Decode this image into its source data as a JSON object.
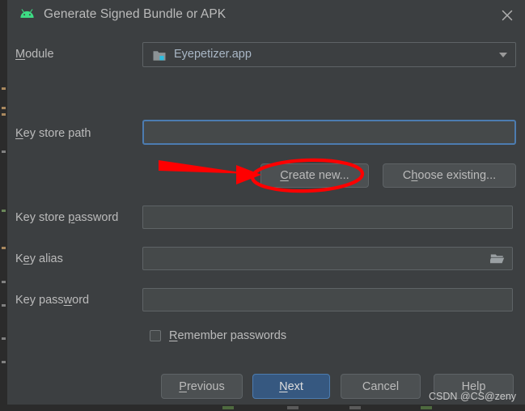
{
  "window": {
    "title": "Generate Signed Bundle or APK",
    "app_icon": "android-robot-icon",
    "close_icon": "close-icon",
    "background_color": "#3C3F41",
    "accent_color": "#4C7CB0",
    "annotation_color": "#FF0000"
  },
  "form": {
    "module": {
      "label_prefix": "",
      "label_mnemonic": "M",
      "label_suffix": "odule",
      "value": "Eyepetizer.app",
      "icon": "folder-module-icon",
      "dropdown_icon": "chevron-down-icon"
    },
    "key_store_path": {
      "label_prefix": "",
      "label_mnemonic": "K",
      "label_suffix": "ey store path",
      "value": "",
      "placeholder": "",
      "focused": true
    },
    "key_store_password": {
      "label_prefix": "Key store ",
      "label_mnemonic": "p",
      "label_suffix": "assword",
      "value": "",
      "placeholder": ""
    },
    "key_alias": {
      "label_prefix": "K",
      "label_mnemonic": "e",
      "label_suffix": "y alias",
      "value": "",
      "placeholder": "",
      "icon": "folder-open-icon"
    },
    "key_password": {
      "label_prefix": "Key pass",
      "label_mnemonic": "w",
      "label_suffix": "ord",
      "value": "",
      "placeholder": ""
    },
    "remember_passwords": {
      "label_prefix": "",
      "label_mnemonic": "R",
      "label_suffix": "emember passwords",
      "checked": false
    }
  },
  "keystore_buttons": {
    "create_new": {
      "prefix": "",
      "mnemonic": "C",
      "suffix": "reate new..."
    },
    "choose_existing": {
      "prefix": "C",
      "mnemonic": "h",
      "suffix": "oose existing..."
    }
  },
  "footer_buttons": {
    "previous": {
      "prefix": "",
      "mnemonic": "P",
      "suffix": "revious"
    },
    "next": {
      "prefix": "",
      "mnemonic": "N",
      "suffix": "ext"
    },
    "cancel": {
      "prefix": "Cancel",
      "mnemonic": "",
      "suffix": ""
    },
    "help": {
      "prefix": "Help",
      "mnemonic": "",
      "suffix": ""
    }
  },
  "watermark": {
    "text": "CSDN @CS@zeny"
  }
}
